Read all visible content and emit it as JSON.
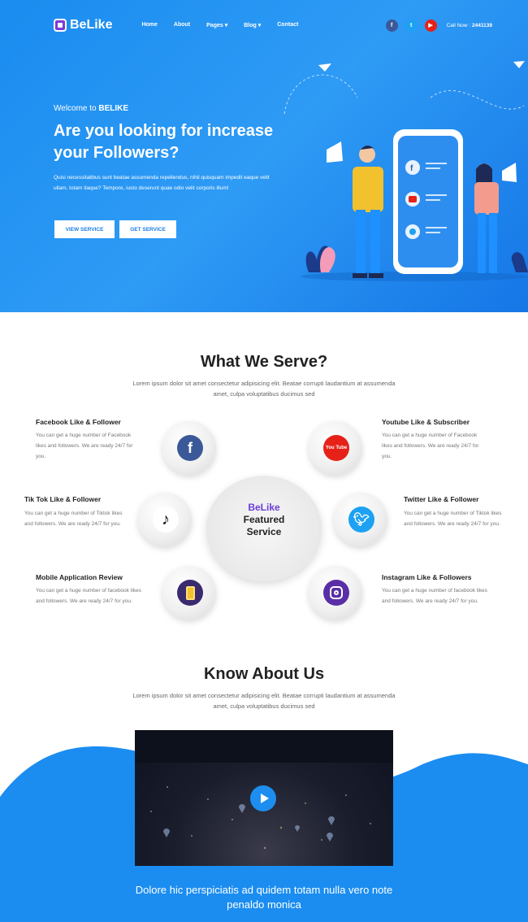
{
  "nav": {
    "logo": "BeLike",
    "items": [
      "Home",
      "About",
      "Pages ▾",
      "Blog ▾",
      "Contact"
    ],
    "call_label": "Call Now :",
    "call_number": "2441139"
  },
  "hero": {
    "welcome_prefix": "Welcome to ",
    "welcome_brand": "BELIKE",
    "title": "Are you looking for increase your Followers?",
    "desc": "Quisi necessitatibus sunt beatae assumenda repellendus, nihil quisquam impedit eaque velit ullam, totam itaque? Tempore, iusto deserunt quae odio velit corporis illum!",
    "btn_primary": "VIEW SERVICE",
    "btn_secondary": "GET SERVICE"
  },
  "serve": {
    "title": "What We Serve?",
    "subtitle": "Lorem ipsum dolor sit amet consectetur adipisicing elit. Beatae corrupti laudantium at assumenda amet, culpa voluptatibus ducimus sed",
    "center_brand": "BeLike",
    "center_line2": "Featured",
    "center_line3": "Service",
    "services": [
      {
        "title": "Facebook Like & Follower",
        "desc": "You can get a huge number of Facebook likes and followers. We are ready 24/7 for you."
      },
      {
        "title": "Youtube Like & Subscriber",
        "desc": "You can get a huge number of Facebook likes and followers. We are ready 24/7 for you."
      },
      {
        "title": "Tik Tok Like & Follower",
        "desc": "You can get a huge number of Tiktok likes and followers. We are ready 24/7 for you."
      },
      {
        "title": "Twitter Like & Follower",
        "desc": "You can get a huge number of Tiktok likes and followers. We are ready 24/7 for you."
      },
      {
        "title": "Mobile Application Review",
        "desc": "You can get a huge number of facebook likes and followers. We are ready 24/7 for you."
      },
      {
        "title": "Instagram Like & Followers",
        "desc": "You can get a huge number of facebook likes and followers. We are ready 24/7 for you."
      }
    ],
    "icon_labels": {
      "youtube": "You Tube"
    }
  },
  "about": {
    "title": "Know About Us",
    "subtitle": "Lorem ipsum dolor sit amet consectetur adipisicing elit. Beatae corrupti laudantium at assumenda amet, culpa voluptatibus ducimus sed",
    "bottom_text": "Dolore hic perspiciatis ad quidem totam nulla vero note penaldo monica"
  },
  "colors": {
    "primary": "#1a8cf0",
    "facebook": "#3b5998",
    "twitter": "#1da1f2",
    "youtube": "#e62117",
    "brand_purple": "#6a3ed8"
  },
  "icons": [
    "facebook-icon",
    "twitter-icon",
    "youtube-icon",
    "tiktok-icon",
    "mobile-app-icon",
    "instagram-icon",
    "play-icon"
  ]
}
